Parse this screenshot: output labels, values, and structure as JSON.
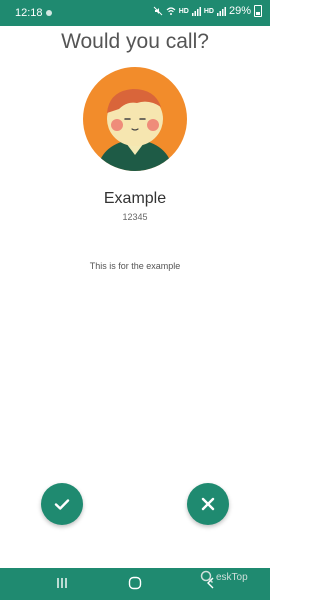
{
  "status_bar": {
    "time": "12:18",
    "network_label_1": "HD",
    "network_label_2": "HD",
    "battery_percent": "29%"
  },
  "dialog": {
    "title": "Would you call?",
    "contact_name": "Example",
    "contact_number": "12345",
    "message": "This is for the example"
  },
  "actions": {
    "accept_icon": "check-icon",
    "decline_icon": "close-icon"
  },
  "navigation": {
    "items": [
      "recent-apps-icon",
      "home-icon",
      "back-icon"
    ]
  },
  "watermark": {
    "text": "eskTop"
  },
  "colors": {
    "accent": "#1f8a70",
    "avatar_bg": "#f28c2b"
  }
}
